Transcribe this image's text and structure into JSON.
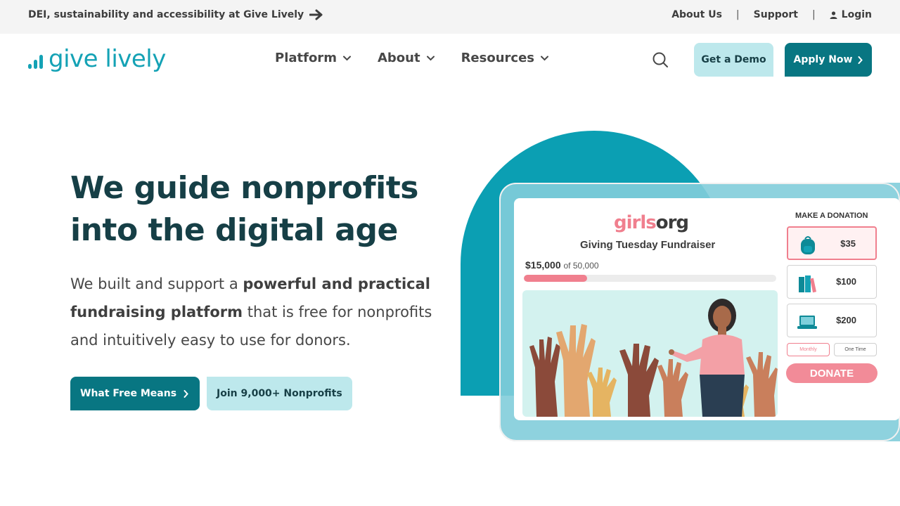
{
  "topbar": {
    "announcement": "DEI, sustainability and accessibility at Give Lively",
    "links": {
      "about": "About Us",
      "support": "Support",
      "login": "Login"
    }
  },
  "header": {
    "logo_text": "give lively",
    "nav": [
      {
        "label": "Platform"
      },
      {
        "label": "About"
      },
      {
        "label": "Resources"
      }
    ],
    "demo_button": "Get a Demo",
    "apply_button": "Apply Now"
  },
  "hero": {
    "title": "We guide nonprofits into the digital age",
    "desc_pre": "We built and support a ",
    "desc_bold": "powerful and practical fundraising platform",
    "desc_post": " that is free for nonprofits and intuitively easy to use for donors.",
    "button_primary": "What Free Means",
    "button_secondary": "Join 9,000+ Nonprofits"
  },
  "illustration": {
    "org_logo_a": "girls",
    "org_logo_b": "org",
    "campaign_title": "Giving Tuesday Fundraiser",
    "raised": "$15,000",
    "goal": "of 50,000",
    "progress_fraction": 0.25,
    "donation_header": "MAKE A DONATION",
    "options": [
      {
        "amount": "$35",
        "icon": "backpack-icon",
        "selected": true
      },
      {
        "amount": "$100",
        "icon": "books-icon",
        "selected": false
      },
      {
        "amount": "$200",
        "icon": "laptop-icon",
        "selected": false
      }
    ],
    "freq_monthly": "Monthly",
    "freq_onetime": "One Time",
    "donate_label": "DONATE"
  },
  "colors": {
    "brand_teal": "#14a2b5",
    "dark_teal": "#087682",
    "light_teal": "#bde8ec",
    "heading": "#163f46",
    "pink": "#f07f8e"
  }
}
